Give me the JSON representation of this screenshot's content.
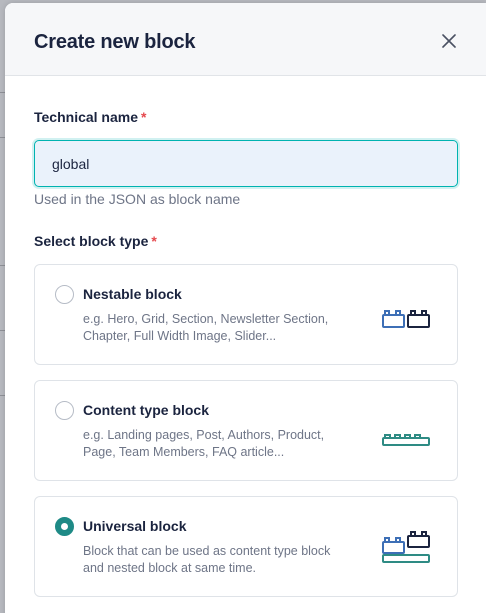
{
  "modal": {
    "title": "Create new block",
    "close_icon": "close-icon"
  },
  "technical_name": {
    "label": "Technical name",
    "required_mark": "*",
    "value": "global",
    "hint": "Used in the JSON as block name"
  },
  "block_type": {
    "label": "Select block type",
    "required_mark": "*",
    "selected": "universal",
    "options": [
      {
        "id": "nestable",
        "title": "Nestable block",
        "description": "e.g. Hero, Grid, Section, Newsletter Section, Chapter, Full Width Image, Slider...",
        "icon": "nestable-block-icon",
        "checked": false
      },
      {
        "id": "content_type",
        "title": "Content type block",
        "description": "e.g. Landing pages, Post, Authors, Product, Page, Team Members, FAQ article...",
        "icon": "content-type-block-icon",
        "checked": false
      },
      {
        "id": "universal",
        "title": "Universal block",
        "description": "Block that can be used as content type block and nested block at same time.",
        "icon": "universal-block-icon",
        "checked": true
      }
    ]
  },
  "colors": {
    "accent": "#00b3b0",
    "radio_checked": "#1e8a86",
    "block_blue": "#3d6fb6",
    "block_dark": "#1b243f",
    "block_teal": "#2e8b84",
    "required": "#e5484d"
  }
}
